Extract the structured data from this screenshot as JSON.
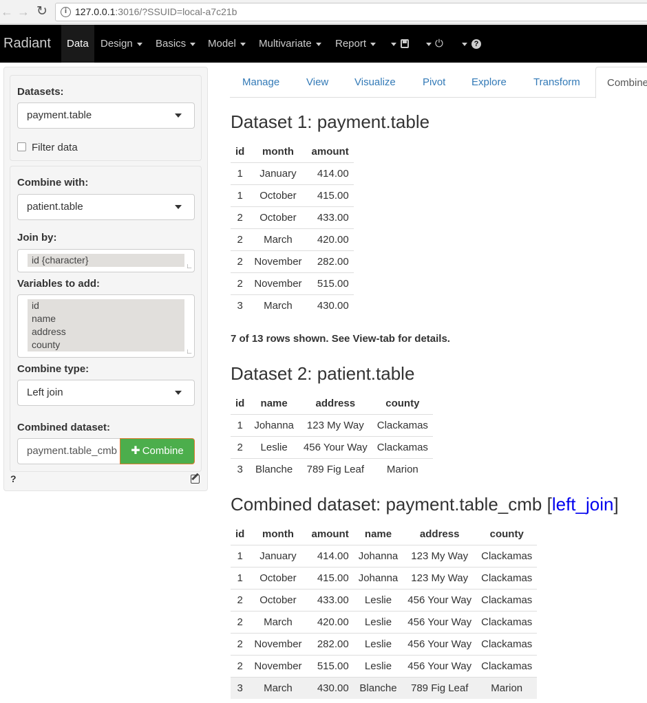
{
  "browser": {
    "url_host": "127.0.0.1",
    "url_rest": ":3016/?SSUID=local-a7c21b"
  },
  "navbar": {
    "brand": "Radiant",
    "items": [
      {
        "label": "Data"
      },
      {
        "label": "Design"
      },
      {
        "label": "Basics"
      },
      {
        "label": "Model"
      },
      {
        "label": "Multivariate"
      },
      {
        "label": "Report"
      }
    ],
    "icons": [
      "save-icon",
      "power-icon",
      "question-circle-icon"
    ]
  },
  "sidebar": {
    "datasets_label": "Datasets:",
    "datasets_value": "payment.table",
    "filter_label": "Filter data",
    "combine_with_label": "Combine with:",
    "combine_with_value": "patient.table",
    "join_by_label": "Join by:",
    "join_by_options": [
      "id {character}"
    ],
    "variables_label": "Variables to add:",
    "variables_options": [
      "id",
      "name",
      "address",
      "county"
    ],
    "combine_type_label": "Combine type:",
    "combine_type_value": "Left join",
    "combined_dataset_label": "Combined dataset:",
    "combined_dataset_value": "payment.table_cmb",
    "combine_button": "Combine",
    "help": "?"
  },
  "tabs": [
    "Manage",
    "View",
    "Visualize",
    "Pivot",
    "Explore",
    "Transform",
    "Combine"
  ],
  "main": {
    "dataset1_title": "Dataset 1: payment.table",
    "dataset1": {
      "columns": [
        "id",
        "month",
        "amount"
      ],
      "rows": [
        [
          "1",
          "January",
          "414.00"
        ],
        [
          "1",
          "October",
          "415.00"
        ],
        [
          "2",
          "October",
          "433.00"
        ],
        [
          "2",
          "March",
          "420.00"
        ],
        [
          "2",
          "November",
          "282.00"
        ],
        [
          "2",
          "November",
          "515.00"
        ],
        [
          "3",
          "March",
          "430.00"
        ]
      ]
    },
    "rows_note": "7 of 13 rows shown. See View-tab for details.",
    "dataset2_title": "Dataset 2: patient.table",
    "dataset2": {
      "columns": [
        "id",
        "name",
        "address",
        "county"
      ],
      "rows": [
        [
          "1",
          "Johanna",
          "123 My Way",
          "Clackamas"
        ],
        [
          "2",
          "Leslie",
          "456 Your Way",
          "Clackamas"
        ],
        [
          "3",
          "Blanche",
          "789 Fig Leaf",
          "Marion"
        ]
      ]
    },
    "combined_title_prefix": "Combined dataset: payment.table_cmb [",
    "combined_title_link": "left_join",
    "combined_title_suffix": "]",
    "combined": {
      "columns": [
        "id",
        "month",
        "amount",
        "name",
        "address",
        "county"
      ],
      "rows": [
        [
          "1",
          "January",
          "414.00",
          "Johanna",
          "123 My Way",
          "Clackamas"
        ],
        [
          "1",
          "October",
          "415.00",
          "Johanna",
          "123 My Way",
          "Clackamas"
        ],
        [
          "2",
          "October",
          "433.00",
          "Leslie",
          "456 Your Way",
          "Clackamas"
        ],
        [
          "2",
          "March",
          "420.00",
          "Leslie",
          "456 Your Way",
          "Clackamas"
        ],
        [
          "2",
          "November",
          "282.00",
          "Leslie",
          "456 Your Way",
          "Clackamas"
        ],
        [
          "2",
          "November",
          "515.00",
          "Leslie",
          "456 Your Way",
          "Clackamas"
        ],
        [
          "3",
          "March",
          "430.00",
          "Blanche",
          "789 Fig Leaf",
          "Marion"
        ]
      ]
    }
  }
}
